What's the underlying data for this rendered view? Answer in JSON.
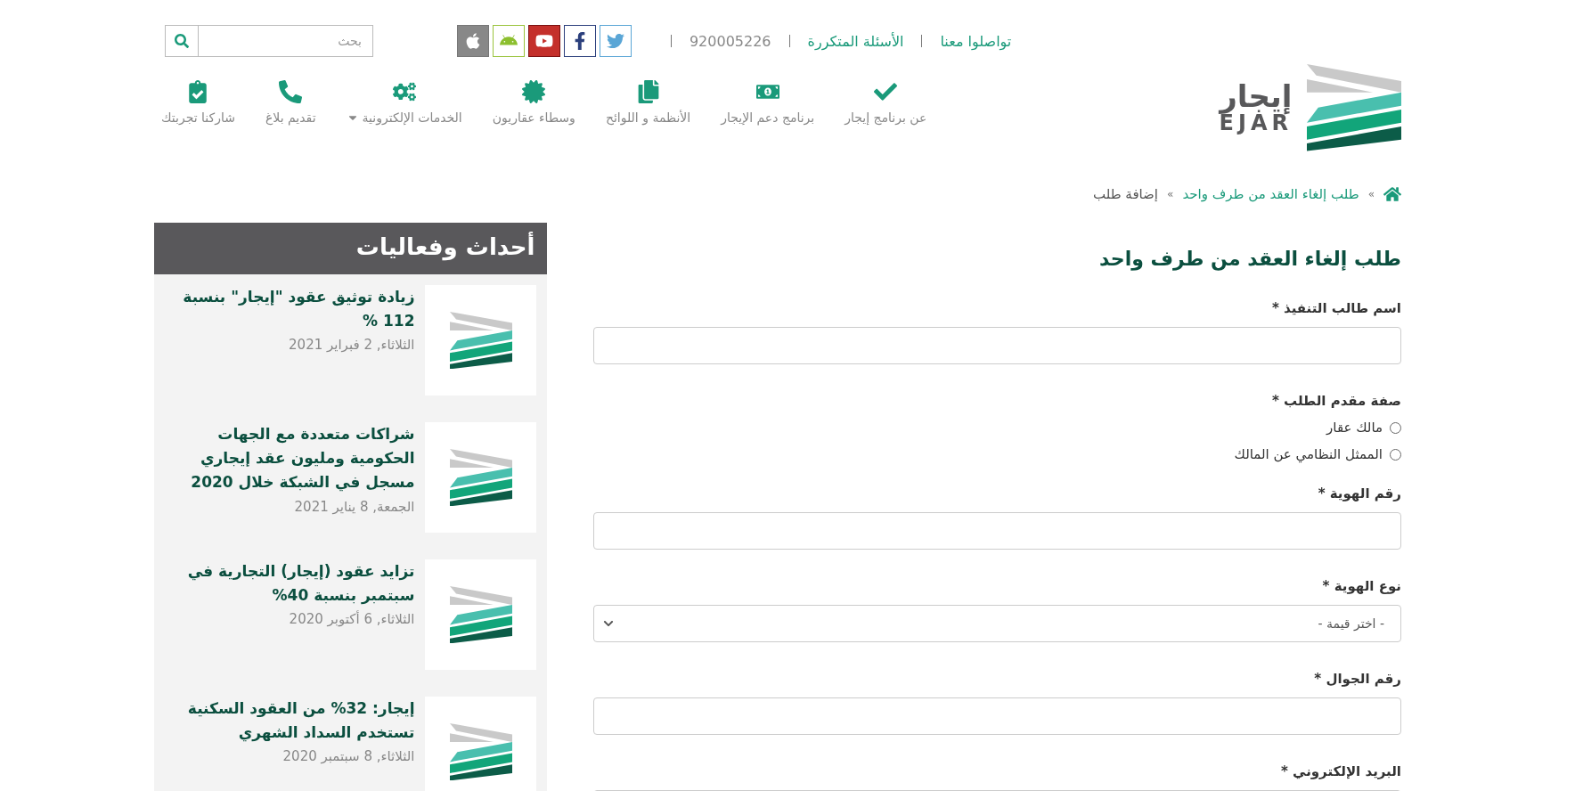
{
  "logo": {
    "arabic": "إيجار",
    "latin": "EJAR"
  },
  "search": {
    "placeholder": "بحث"
  },
  "top_links": [
    {
      "text": "تواصلوا معنا",
      "kind": "link"
    },
    {
      "text": "الأسئلة المتكررة",
      "kind": "link"
    },
    {
      "text": "920005226",
      "kind": "phone"
    }
  ],
  "nav": [
    {
      "label": "عن برنامج إيجار",
      "has_dropdown": false
    },
    {
      "label": "برنامج دعم الإيجار",
      "has_dropdown": false
    },
    {
      "label": "الأنظمة و اللوائح",
      "has_dropdown": false
    },
    {
      "label": "وسطاء عقاريون",
      "has_dropdown": false
    },
    {
      "label": "الخدمات الإلكترونية",
      "has_dropdown": true
    },
    {
      "label": "تقديم بلاغ",
      "has_dropdown": false
    },
    {
      "label": "شاركنا تجربتك",
      "has_dropdown": false
    }
  ],
  "breadcrumb": [
    {
      "kind": "home"
    },
    {
      "kind": "separator",
      "text": "»"
    },
    {
      "kind": "link",
      "text": "طلب إلغاء العقد من طرف واحد"
    },
    {
      "kind": "separator",
      "text": "»"
    },
    {
      "kind": "current",
      "text": "إضافة طلب"
    }
  ],
  "form": {
    "title": "طلب إلغاء العقد من طرف واحد",
    "fields": [
      {
        "kind": "text",
        "label": "اسم طالب التنفيذ *"
      },
      {
        "kind": "radio",
        "label": "صفة مقدم الطلب *",
        "options": [
          {
            "label": "مالك عقار",
            "selected": false
          },
          {
            "label": "الممثل النظامي عن المالك",
            "selected": false
          }
        ]
      },
      {
        "kind": "text",
        "label": "رقم الهوية *"
      },
      {
        "kind": "select",
        "label": "نوع الهوية *",
        "value": "- اختر قيمة -"
      },
      {
        "kind": "text",
        "label": "رقم الجوال *"
      },
      {
        "kind": "text",
        "label": "البريد الإلكتروني *"
      }
    ]
  },
  "events": {
    "title": "أحداث وفعاليات",
    "items": [
      {
        "title": "زيادة توثيق عقود \"إيجار\" بنسبة 112 %",
        "date": "الثلاثاء, 2 فبراير 2021"
      },
      {
        "title": "شراكات متعددة مع الجهات الحكومية ومليون عقد إيجاري مسجل في الشبكة خلال 2020",
        "date": "الجمعة, 8 يناير 2021"
      },
      {
        "title": "تزايد عقود (إيجار) التجارية في سبتمبر بنسبة 40%",
        "date": "الثلاثاء, 6 أكتوبر 2020"
      },
      {
        "title": "إيجار: 32% من العقود السكنية تستخدم السداد الشهري",
        "date": "الثلاثاء, 8 سبتمبر 2020"
      }
    ]
  }
}
